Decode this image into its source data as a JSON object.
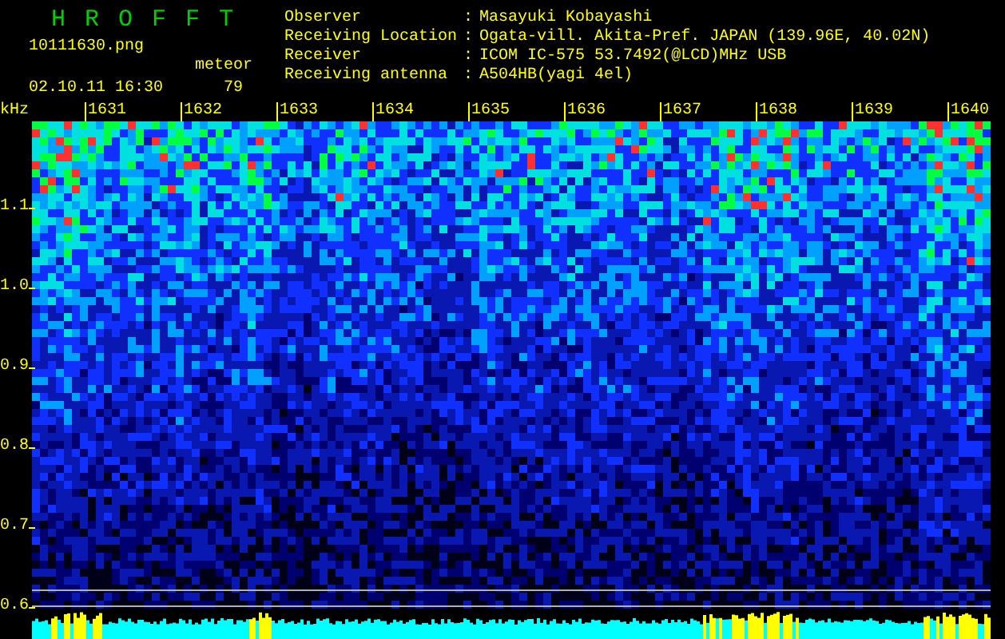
{
  "header": {
    "title": "HROFFT",
    "filename": "10111630.png",
    "datetime": "02.10.11 16:30",
    "meteor_label": "meteor",
    "meteor_count": "79"
  },
  "info": [
    {
      "label": "Observer",
      "separator": ":",
      "value": "Masayuki Kobayashi"
    },
    {
      "label": "Receiving Location",
      "separator": ":",
      "value": "Ogata-vill. Akita-Pref. JAPAN (139.96E, 40.02N)"
    },
    {
      "label": "Receiver",
      "separator": ":",
      "value": "ICOM IC-575 53.7492(@LCD)MHz USB"
    },
    {
      "label": "Receiving antenna",
      "separator": ":",
      "value": "A504HB(yagi 4el)"
    }
  ],
  "plot": {
    "y_unit": "kHz",
    "y_labels": [
      "1.1",
      "1.0",
      "0.9",
      "0.8",
      "0.7",
      "0.6"
    ],
    "time_labels": [
      "1631",
      "1632",
      "1633",
      "1634",
      "1635",
      "1636",
      "1637",
      "1638",
      "1639",
      "1640"
    ]
  }
}
